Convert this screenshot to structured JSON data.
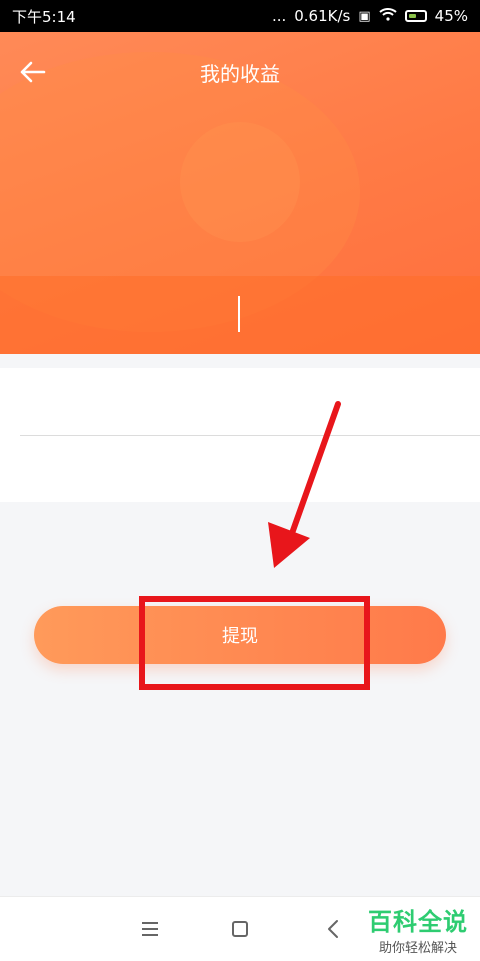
{
  "status_bar": {
    "time": "下午5:14",
    "dots": "...",
    "network_speed": "0.61K/s",
    "battery_percent": "45%",
    "icons": [
      "sim-icon",
      "wifi-icon",
      "battery-icon"
    ]
  },
  "header": {
    "title": "我的收益",
    "back_icon": "arrow-left-icon"
  },
  "main": {
    "withdraw_label": "提现"
  },
  "watermark": {
    "main": "百科全说",
    "sub": "助你轻松解决"
  },
  "colors": {
    "accent": "#ff7a45",
    "annotation": "#e8161b"
  }
}
